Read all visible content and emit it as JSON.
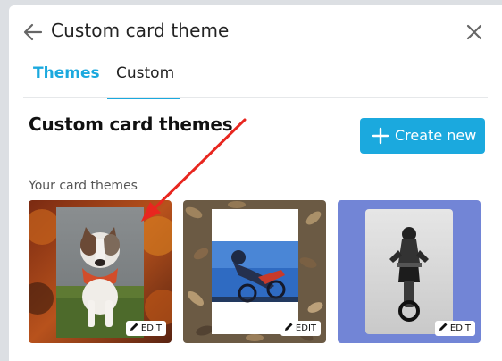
{
  "dialog": {
    "title": "Custom card theme",
    "back_icon": "arrow-left-icon",
    "close_icon": "close-icon"
  },
  "tabs": [
    {
      "label": "Themes",
      "active": false,
      "color": "#1ba9de"
    },
    {
      "label": "Custom",
      "active": true
    }
  ],
  "main": {
    "section_title": "Custom card themes",
    "create_button": {
      "label": "Create new",
      "icon": "plus-icon"
    },
    "subheading": "Your card themes",
    "cards": [
      {
        "name": "dog-autumn-theme",
        "edit_label": "EDIT"
      },
      {
        "name": "motocross-leaves-theme",
        "edit_label": "EDIT"
      },
      {
        "name": "motocross-blue-theme",
        "edit_label": "EDIT"
      }
    ]
  },
  "colors": {
    "accent": "#1ba9de",
    "annotation_arrow": "#e8261f"
  }
}
